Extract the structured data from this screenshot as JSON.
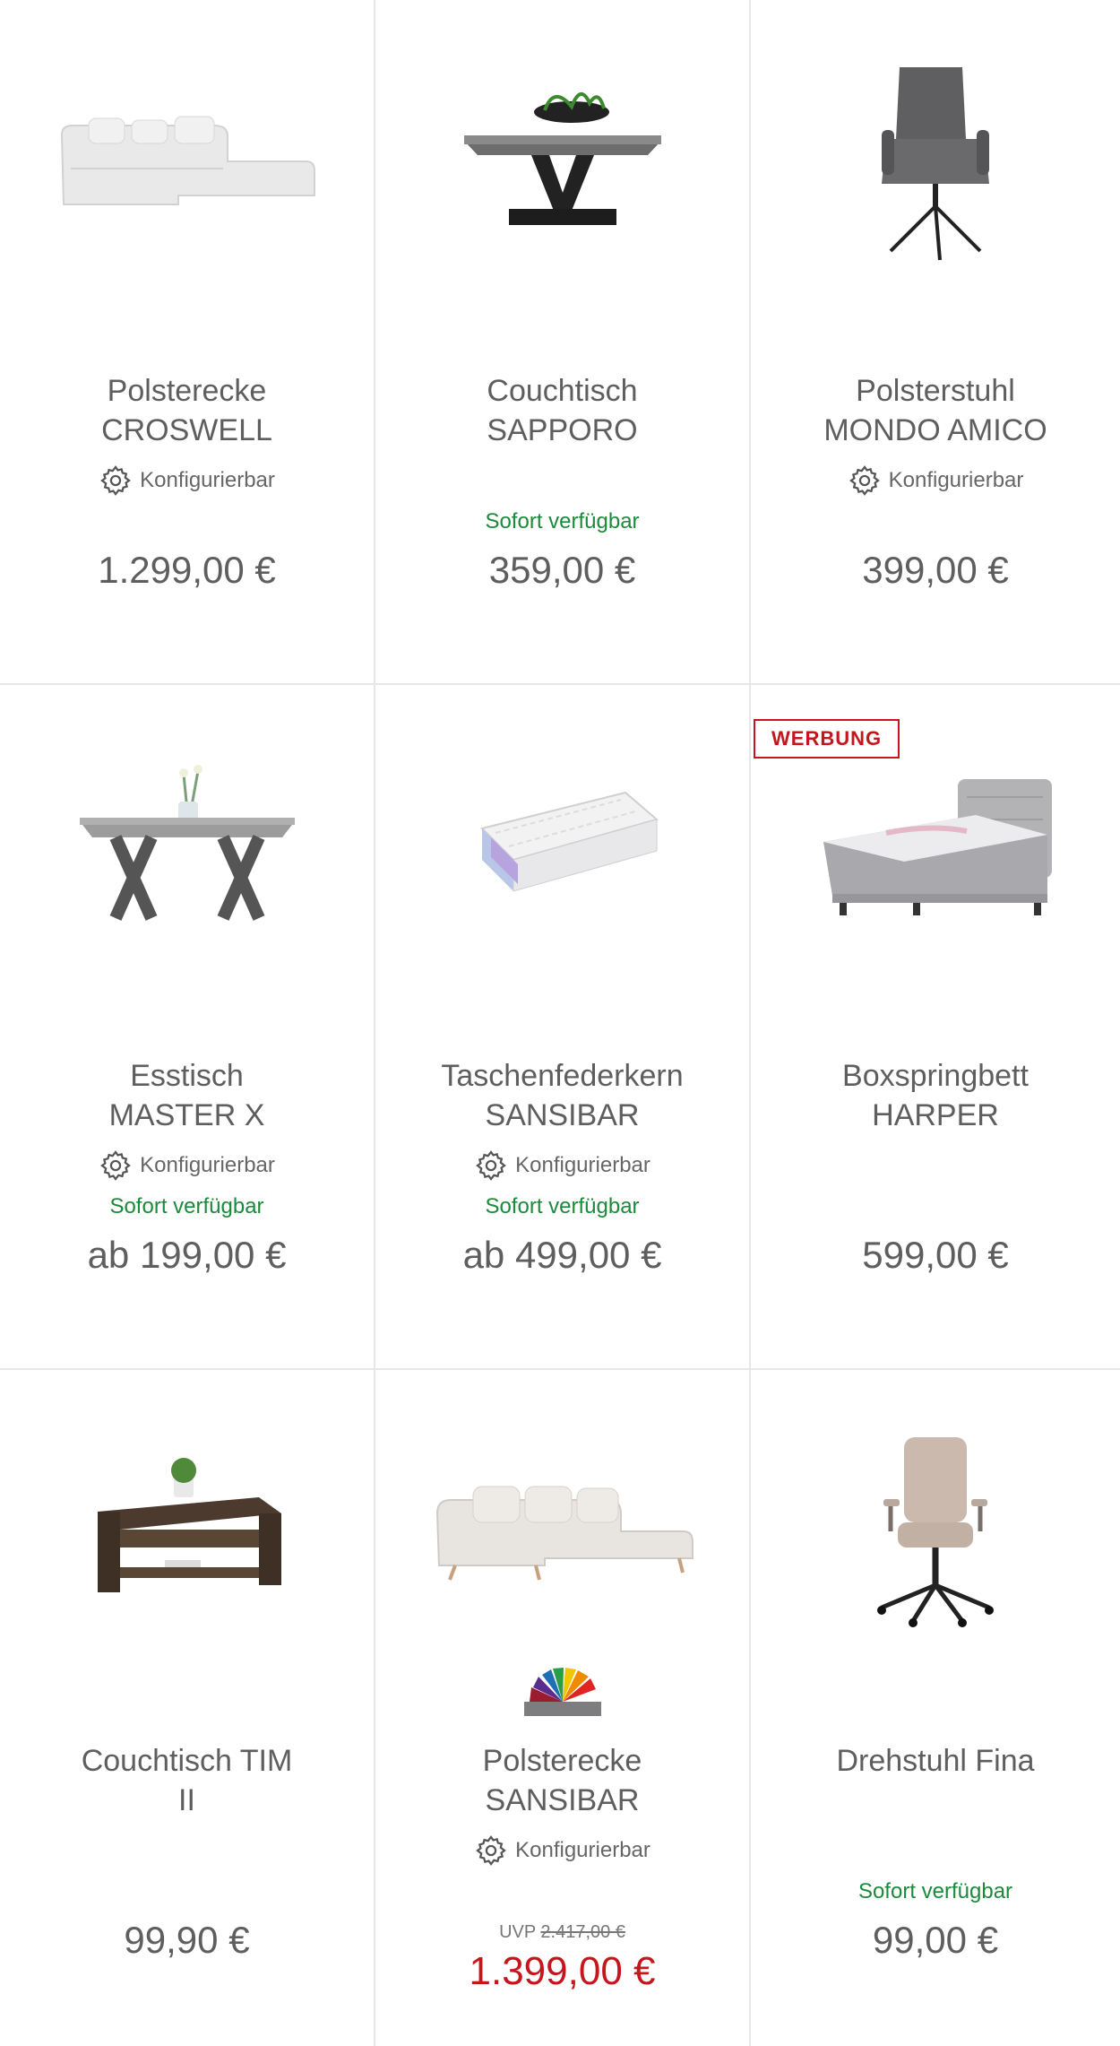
{
  "products": [
    {
      "title": [
        "Polsterecke",
        "CROSWELL"
      ],
      "config": "Konfigurierbar",
      "availability": "",
      "price": "1.299,00 €"
    },
    {
      "title": [
        "Couchtisch",
        "SAPPORO"
      ],
      "config": "",
      "availability": "Sofort verfügbar",
      "price": "359,00 €"
    },
    {
      "title": [
        "Polsterstuhl",
        "MONDO AMICO"
      ],
      "config": "Konfigurierbar",
      "availability": "",
      "price": "399,00 €"
    },
    {
      "title": [
        "Esstisch",
        "MASTER X"
      ],
      "config": "Konfigurierbar",
      "availability": "Sofort verfügbar",
      "price": "ab 199,00 €"
    },
    {
      "title": [
        "Taschenfederkern",
        "SANSIBAR"
      ],
      "config": "Konfigurierbar",
      "availability": "Sofort verfügbar",
      "price": "ab 499,00 €"
    },
    {
      "title": [
        "Boxspringbett",
        "HARPER"
      ],
      "config": "",
      "availability": "",
      "price": "599,00 €",
      "badge": "WERBUNG"
    },
    {
      "title": [
        "Couchtisch TIM",
        "II"
      ],
      "config": "",
      "availability": "",
      "price": "99,90 €"
    },
    {
      "title": [
        "Polsterecke",
        "SANSIBAR"
      ],
      "config": "Konfigurierbar",
      "availability": "",
      "uvp_label": "UVP",
      "uvp_price": "2.417,00 €",
      "price": "1.399,00 €"
    },
    {
      "title": [
        "Drehstuhl Fina",
        ""
      ],
      "config": "",
      "availability": "Sofort verfügbar",
      "price": "99,00 €"
    }
  ],
  "colors": {
    "availability_green": "#1b8a3b",
    "sale_red": "#c4161c",
    "text_gray": "#5e5e5e",
    "divider": "#e7e7e7"
  }
}
